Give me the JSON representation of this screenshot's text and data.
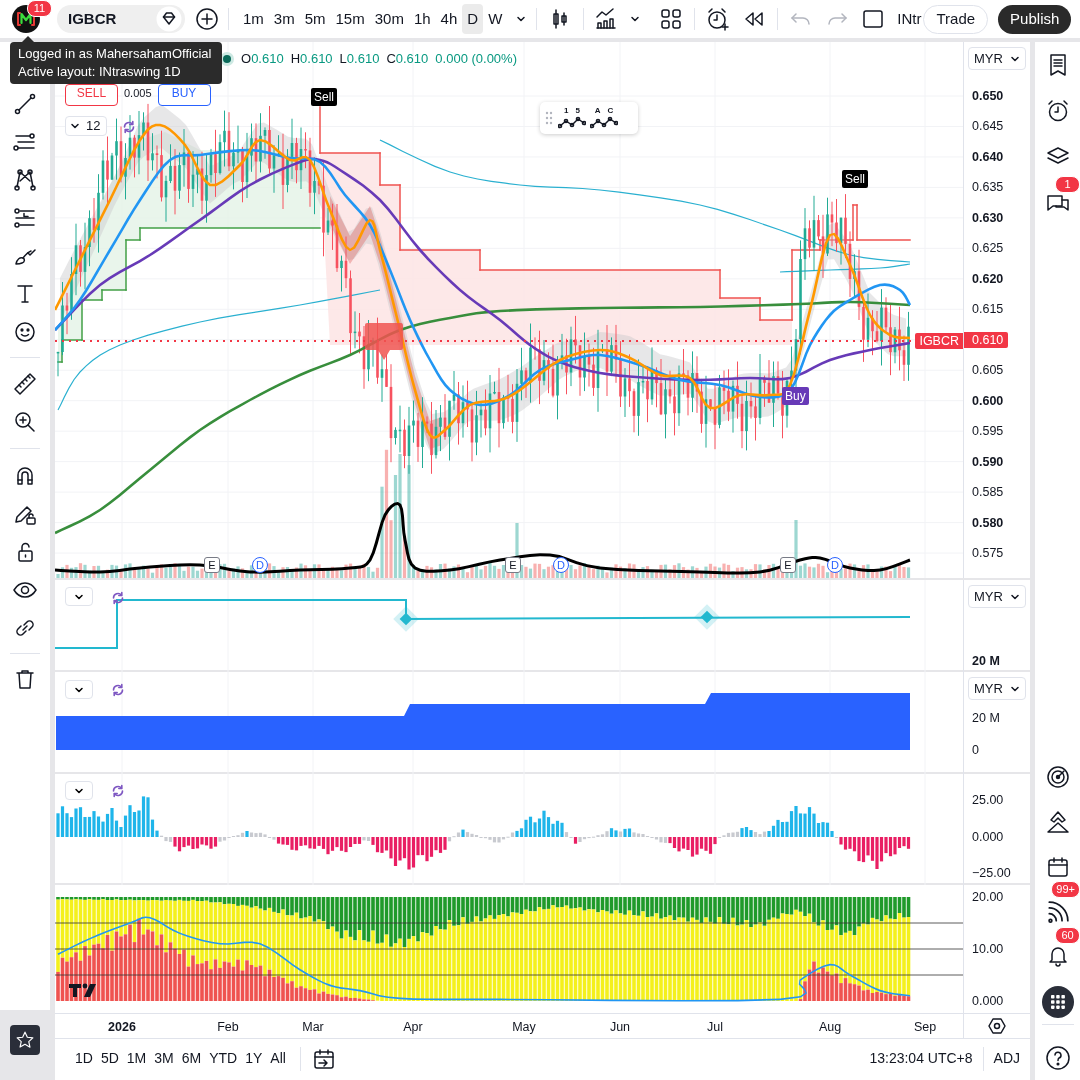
{
  "top_toolbar": {
    "notifications_badge": "11",
    "symbol": "IGBCR",
    "intervals": [
      {
        "label": "1m",
        "selected": false
      },
      {
        "label": "3m",
        "selected": false
      },
      {
        "label": "5m",
        "selected": false
      },
      {
        "label": "15m",
        "selected": false
      },
      {
        "label": "30m",
        "selected": false
      },
      {
        "label": "1h",
        "selected": false
      },
      {
        "label": "4h",
        "selected": false
      },
      {
        "label": "D",
        "selected": true
      },
      {
        "label": "W",
        "selected": false
      }
    ],
    "layout_name": "INtr",
    "trade_button": "Trade",
    "publish_button": "Publish"
  },
  "tooltip": {
    "lines": [
      "Logged in as MahersahamOfficial",
      "Active layout: INtraswing 1D"
    ]
  },
  "main_pane": {
    "legend": {
      "ohlc": [
        {
          "key": "O",
          "value": "0.610"
        },
        {
          "key": "H",
          "value": "0.610"
        },
        {
          "key": "L",
          "value": "0.610"
        },
        {
          "key": "C",
          "value": "0.610"
        }
      ],
      "change": "0.000 (0.00%)"
    },
    "trade_panel": {
      "sell": "SELL",
      "spread": "0.005",
      "buy": "BUY"
    },
    "indicators_count": "12",
    "drawing_toolbar": [
      {
        "labels": [
          "1",
          "5"
        ]
      },
      {
        "labels": [
          "A",
          "C"
        ]
      }
    ],
    "signals": [
      {
        "kind": "sell",
        "label": "Sell"
      },
      {
        "kind": "sell",
        "label": "Sell"
      },
      {
        "kind": "buy",
        "label": "Buy"
      }
    ],
    "events": [
      {
        "kind": "earnings",
        "label": "E"
      },
      {
        "kind": "dividend",
        "label": "D"
      },
      {
        "kind": "earnings",
        "label": "E"
      },
      {
        "kind": "dividend",
        "label": "D"
      },
      {
        "kind": "earnings",
        "label": "E"
      },
      {
        "kind": "dividend",
        "label": "D"
      }
    ],
    "price_line": {
      "symbol": "IGBCR"
    },
    "currency": "MYR",
    "price_axis": [
      {
        "text": "0.650",
        "kind": "major"
      },
      {
        "text": "0.645",
        "kind": "minor"
      },
      {
        "text": "0.640",
        "kind": "major"
      },
      {
        "text": "0.635",
        "kind": "minor"
      },
      {
        "text": "0.630",
        "kind": "major"
      },
      {
        "text": "0.625",
        "kind": "minor"
      },
      {
        "text": "0.620",
        "kind": "major"
      },
      {
        "text": "0.615",
        "kind": "minor"
      },
      {
        "text": "0.610",
        "kind": "current"
      },
      {
        "text": "0.605",
        "kind": "minor"
      },
      {
        "text": "0.600",
        "kind": "major"
      },
      {
        "text": "0.595",
        "kind": "minor"
      },
      {
        "text": "0.590",
        "kind": "major"
      },
      {
        "text": "0.585",
        "kind": "minor"
      },
      {
        "text": "0.580",
        "kind": "major"
      },
      {
        "text": "0.575",
        "kind": "minor"
      }
    ]
  },
  "pane_2": {
    "currency": "MYR",
    "axis": [
      {
        "text": "20 M",
        "kind": "major"
      }
    ]
  },
  "pane_3": {
    "currency": "MYR",
    "axis": [
      {
        "text": "20 M",
        "kind": "minor"
      },
      {
        "text": "0",
        "kind": "minor"
      }
    ]
  },
  "pane_4": {
    "axis": [
      {
        "text": "25.00",
        "kind": "minor"
      },
      {
        "text": "0.000",
        "kind": "minor"
      },
      {
        "text": "−25.00",
        "kind": "minor"
      }
    ]
  },
  "pane_5": {
    "axis": [
      {
        "text": "20.00",
        "kind": "minor"
      },
      {
        "text": "10.00",
        "kind": "minor"
      },
      {
        "text": "0.000",
        "kind": "minor"
      }
    ]
  },
  "time_axis": [
    {
      "text": "2026",
      "kind": "major"
    },
    {
      "text": "Feb",
      "kind": "minor"
    },
    {
      "text": "Mar",
      "kind": "minor"
    },
    {
      "text": "Apr",
      "kind": "minor"
    },
    {
      "text": "May",
      "kind": "minor"
    },
    {
      "text": "Jun",
      "kind": "minor"
    },
    {
      "text": "Jul",
      "kind": "minor"
    },
    {
      "text": "Aug",
      "kind": "minor"
    },
    {
      "text": "Sep",
      "kind": "minor"
    }
  ],
  "bottom_bar": {
    "ranges": [
      "1D",
      "5D",
      "1M",
      "3M",
      "6M",
      "YTD",
      "1Y",
      "All"
    ],
    "clock": "13:23:04 UTC+8",
    "adjustment": "ADJ"
  },
  "right_sidebar": {
    "chat_badge": "1",
    "stream_badge": "99+",
    "alerts_badge": "60"
  }
}
